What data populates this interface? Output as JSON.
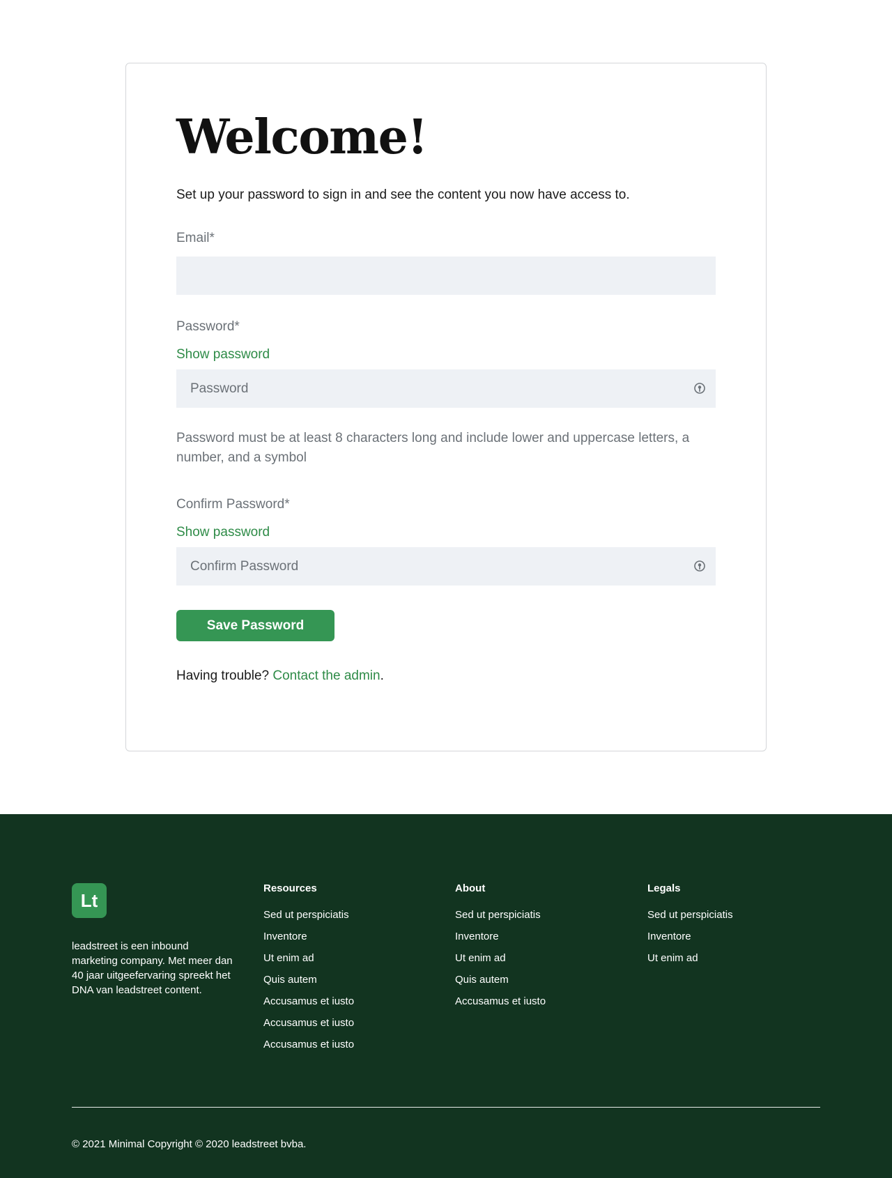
{
  "form": {
    "title": "Welcome!",
    "subtitle": "Set up your password to sign in and see the content you now have access to.",
    "email_label": "Email*",
    "email_value": "",
    "password_label": "Password*",
    "show_password": "Show password",
    "password_placeholder": "Password",
    "password_hint": "Password must be at least 8 characters long and include lower and uppercase letters, a number, and a symbol",
    "confirm_label": "Confirm Password*",
    "confirm_show_password": "Show password",
    "confirm_placeholder": "Confirm Password",
    "save_button": "Save Password",
    "trouble_text": "Having trouble?",
    "contact_link": "Contact the admin",
    "trouble_end": "."
  },
  "footer": {
    "logo_text": "Lt",
    "about": "leadstreet is een inbound marketing company. Met meer dan 40 jaar uitgeefervaring spreekt het DNA van leadstreet content.",
    "columns": [
      {
        "heading": "Resources",
        "links": [
          "Sed ut perspiciatis",
          "Inventore",
          "Ut enim ad",
          "Quis autem",
          "Accusamus et iusto",
          "Accusamus et iusto",
          "Accusamus et iusto"
        ]
      },
      {
        "heading": "About",
        "links": [
          "Sed ut perspiciatis",
          "Inventore",
          "Ut enim ad",
          "Quis autem",
          "Accusamus et iusto"
        ]
      },
      {
        "heading": "Legals",
        "links": [
          "Sed ut perspiciatis",
          "Inventore",
          "Ut enim ad"
        ]
      }
    ],
    "copyright": "© 2021 Minimal Copyright © 2020 leadstreet bvba."
  },
  "colors": {
    "accent": "#359654",
    "link": "#2e8b47",
    "footer_bg": "#123420",
    "field_bg": "#eef1f5"
  }
}
